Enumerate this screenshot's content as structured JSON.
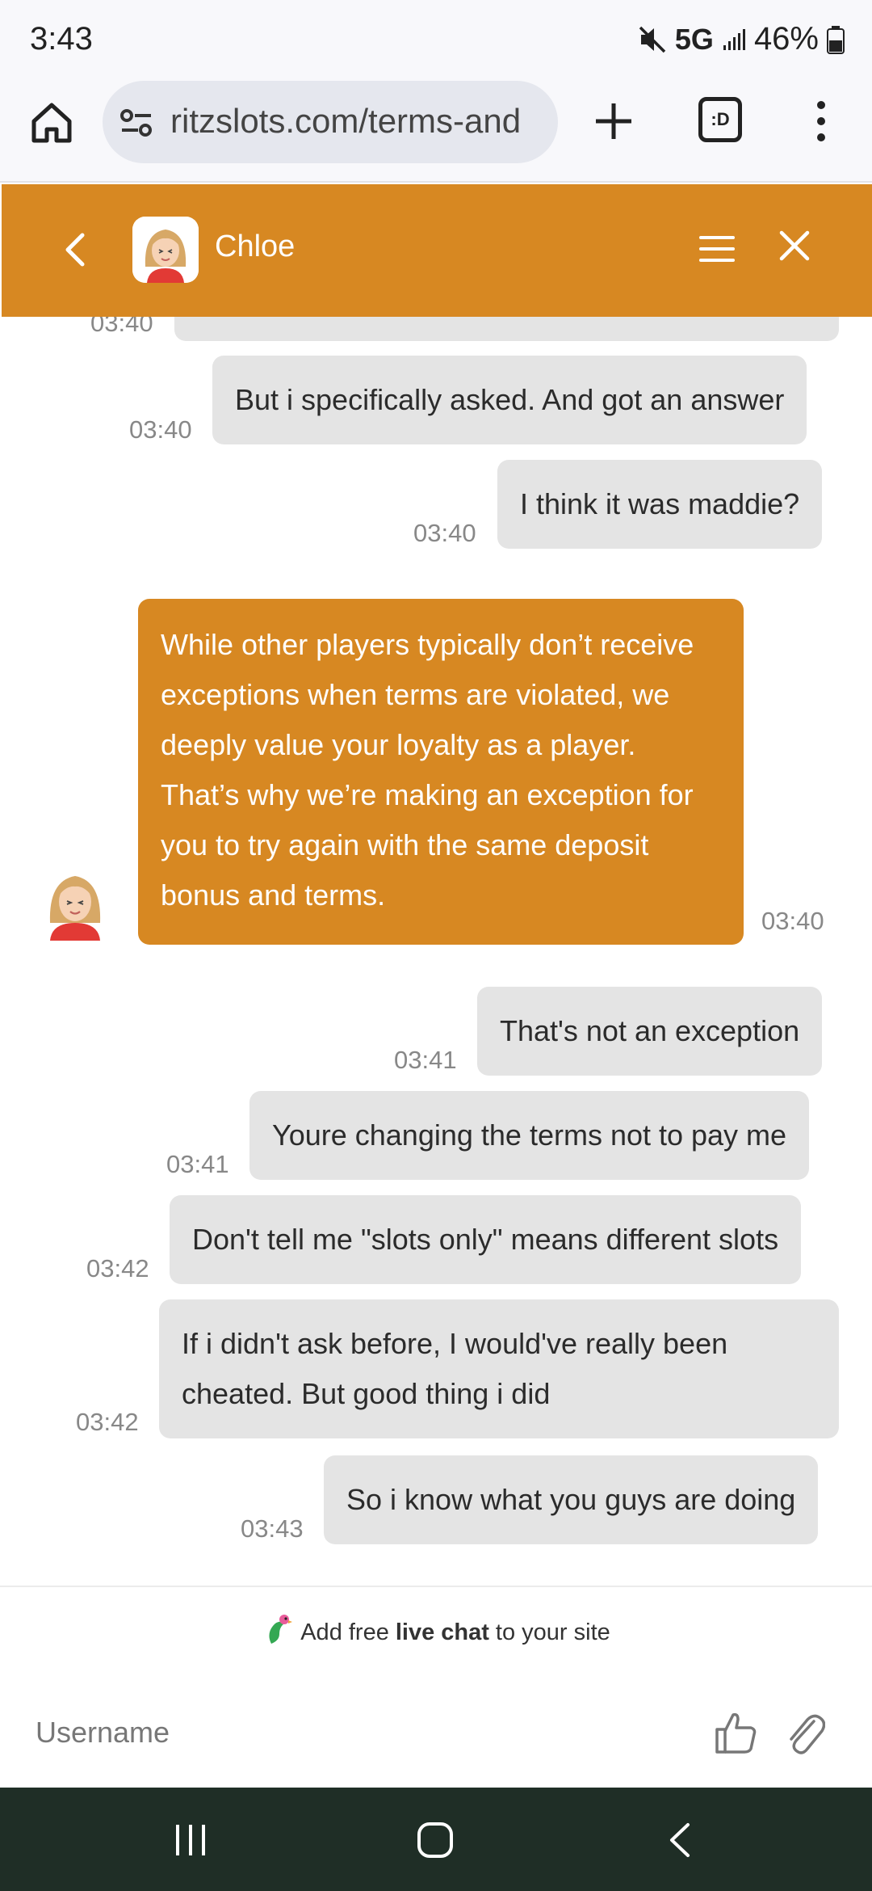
{
  "status_bar": {
    "time": "3:43",
    "network": "5G",
    "battery": "46%"
  },
  "browser": {
    "url": "ritzslots.com/terms-and",
    "tabs_label": ":D"
  },
  "chat_header": {
    "agent_name": "Chloe"
  },
  "messages": [
    {
      "text": "",
      "time": "03:40"
    },
    {
      "text": "But i specifically asked. And got an answer",
      "time": "03:40"
    },
    {
      "text": "I think it was maddie?",
      "time": "03:40"
    },
    {
      "text": "While other players typically don’t receive exceptions when terms are violated, we deeply value your loyalty as a player. That’s why we’re making an exception for you to try again with the same deposit bonus and terms.",
      "time": "03:40",
      "from": "agent"
    },
    {
      "text": "That's not an exception",
      "time": "03:41"
    },
    {
      "text": "Youre changing the terms not to pay me",
      "time": "03:41"
    },
    {
      "text": "Don't tell me \"slots only\" means different slots",
      "time": "03:42"
    },
    {
      "text_line1": "If i didn't ask before, I would've really been",
      "text_line2": "cheated. But good thing i did",
      "time": "03:42"
    },
    {
      "text": "So i know what you guys are doing",
      "time": "03:43"
    }
  ],
  "footer": {
    "powered_prefix": "Add free",
    "powered_bold": "live chat",
    "powered_suffix": "to your site",
    "input_placeholder": "Username"
  },
  "colors": {
    "accent": "#d78822",
    "bubble_gray": "#e4e4e4",
    "nav_bar": "#1f2e26"
  }
}
